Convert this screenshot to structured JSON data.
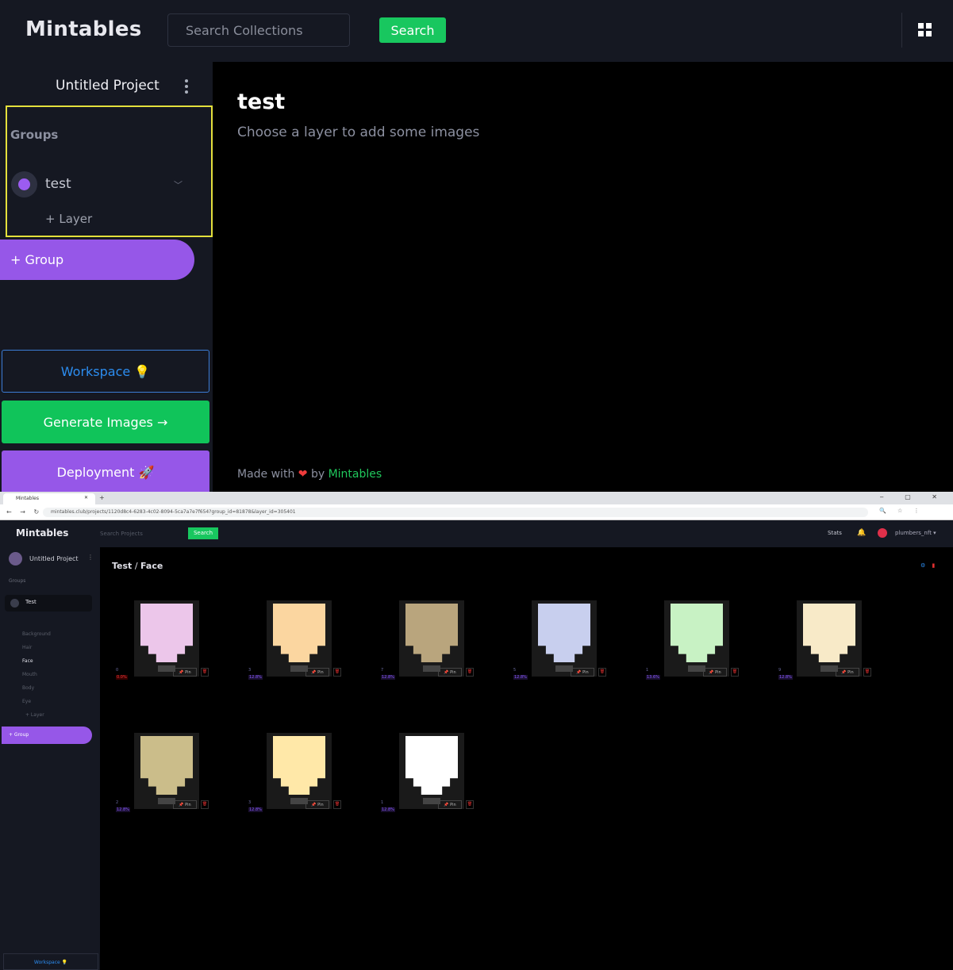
{
  "header": {
    "logo": "Mintables",
    "search_placeholder": "Search Collections",
    "search_button": "Search"
  },
  "sidebar": {
    "project_title": "Untitled Project",
    "groups_label": "Groups",
    "group_name": "test",
    "add_layer": "+ Layer",
    "add_group": "+ Group",
    "workspace_button": "Workspace 💡",
    "generate_button": "Generate Images →",
    "deployment_button": "Deployment 🚀"
  },
  "main": {
    "title": "test",
    "subtitle": "Choose a layer to add some images",
    "footer_prefix": "Made with",
    "footer_heart": "❤",
    "footer_by": "by",
    "footer_link": "Mintables"
  },
  "inset": {
    "tab_title": "Mintables",
    "url": "mintables.club/projects/1120d8c4-6283-4c02-8094-5ca7a7e7f654?group_id=81878&layer_id=305401",
    "logo": "Mintables",
    "search_placeholder": "Search Projects",
    "search_button": "Search",
    "stats": "Stats",
    "username": "plumbers_nft ▾",
    "project_title": "Untitled Project",
    "groups_label": "Groups",
    "group_name": "Test",
    "layers": [
      "Background",
      "Hair",
      "Face",
      "Mouth",
      "Body",
      "Eye"
    ],
    "active_layer": "Face",
    "add_layer": "+ Layer",
    "add_group": "+ Group",
    "workspace": "Workspace 💡",
    "breadcrumb_group": "Test",
    "breadcrumb_sep": "/",
    "breadcrumb_layer": "Face",
    "pin_label": "📌 Pin",
    "delete_label": "🗑",
    "images": [
      {
        "color": "#ecc6ea",
        "num": "0",
        "pct": "0.0%",
        "zero": true
      },
      {
        "color": "#fbd6a0",
        "num": "3",
        "pct": "12.8%",
        "zero": false
      },
      {
        "color": "#b9a57d",
        "num": "7",
        "pct": "12.8%",
        "zero": false
      },
      {
        "color": "#c8cfee",
        "num": "5",
        "pct": "12.8%",
        "zero": false
      },
      {
        "color": "#c8f2c4",
        "num": "1",
        "pct": "13.6%",
        "zero": false
      },
      {
        "color": "#f8eac8",
        "num": "9",
        "pct": "12.8%",
        "zero": false
      },
      {
        "color": "#cbbd8a",
        "num": "2",
        "pct": "12.8%",
        "zero": false
      },
      {
        "color": "#ffe8a8",
        "num": "3",
        "pct": "12.8%",
        "zero": false
      },
      {
        "color": "#ffffff",
        "num": "1",
        "pct": "12.8%",
        "zero": false
      }
    ]
  },
  "colors": {
    "accent_green": "#18c75f",
    "accent_purple": "#9657e8",
    "accent_blue": "#2c8df0",
    "highlight": "#e4e03c",
    "panel_bg": "#151822"
  }
}
